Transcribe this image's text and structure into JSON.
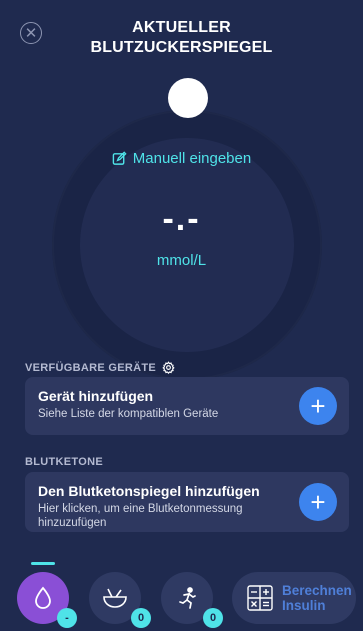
{
  "header": {
    "title_line1": "AKTUELLER",
    "title_line2": "BLUTZUCKERSPIEGEL"
  },
  "gauge": {
    "manual_entry_label": "Manuell eingeben",
    "value": "-.-",
    "unit": "mmol/L"
  },
  "devices_section": {
    "label": "VERFÜGBARE GERÄTE",
    "card_title": "Gerät hinzufügen",
    "card_subtitle": "Siehe Liste der kompatiblen Geräte"
  },
  "ketones_section": {
    "label": "BLUTKETONE",
    "card_title": "Den Blutketonspiegel hinzufügen",
    "card_subtitle": "Hier klicken, um eine Blutketonmessung hinzuzufügen"
  },
  "bottom_nav": {
    "glucose_badge": "-",
    "meal_badge": "0",
    "activity_badge": "0",
    "calc_label_line1": "Berechnen",
    "calc_label_line2": "Insulin"
  },
  "colors": {
    "background": "#1f2a4f",
    "accent_cyan": "#4fe3e8",
    "button_blue": "#3d84ee",
    "active_purple": "#8a4fd6"
  }
}
